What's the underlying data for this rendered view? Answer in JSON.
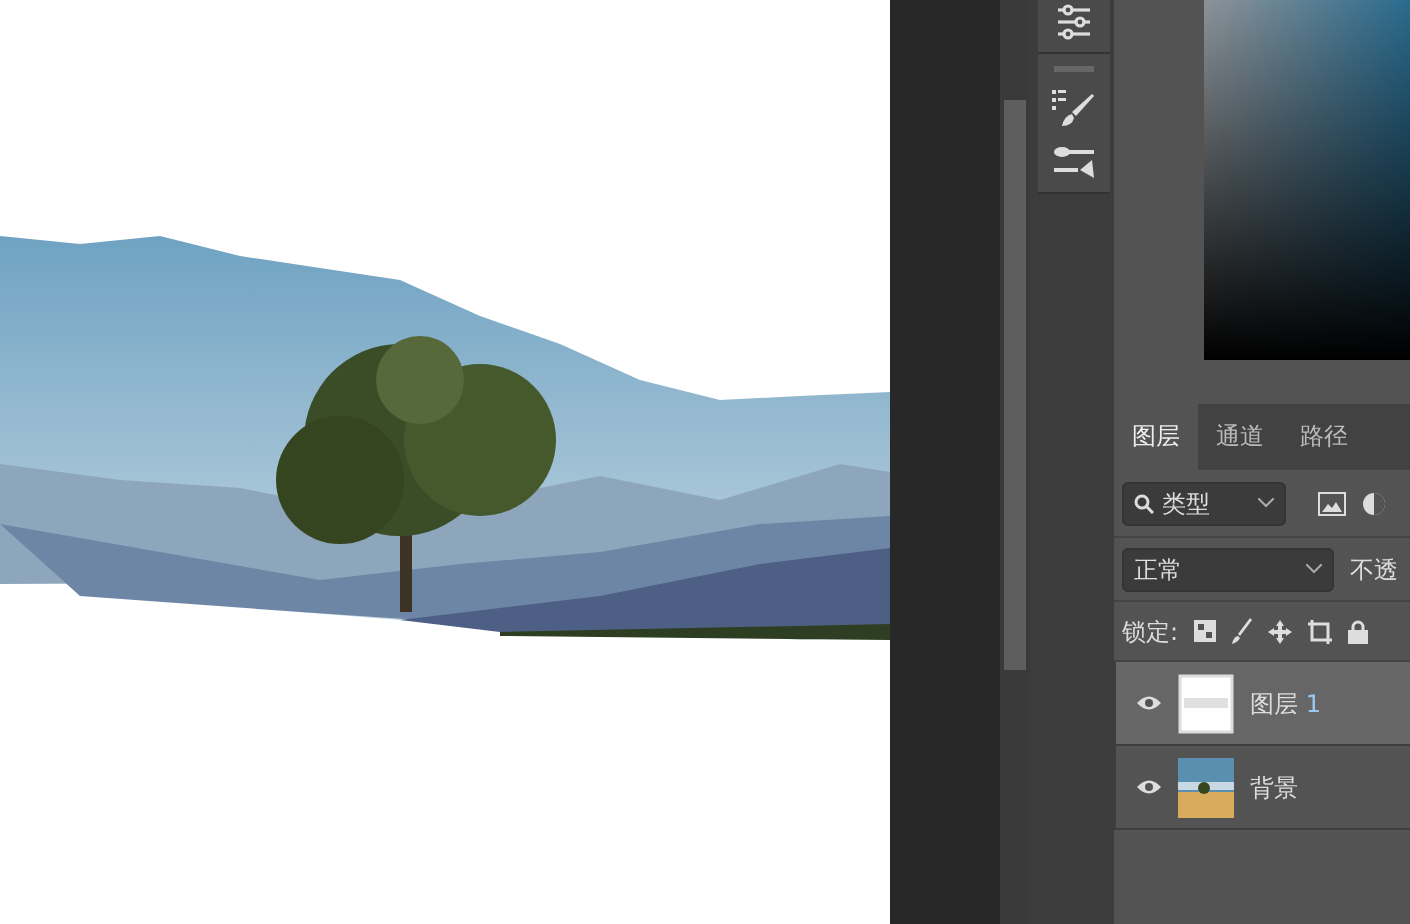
{
  "layers_panel": {
    "tabs": [
      {
        "label": "图层",
        "selected": true
      },
      {
        "label": "通道",
        "selected": false
      },
      {
        "label": "路径",
        "selected": false
      }
    ],
    "filter": {
      "value": "类型"
    },
    "blend_mode": {
      "value": "正常"
    },
    "opacity_label": "不透",
    "lock_label": "锁定:",
    "layers": [
      {
        "name": "图层",
        "suffix": "1",
        "selected": true,
        "visible": true,
        "kind": "transparent"
      },
      {
        "name": "背景",
        "selected": false,
        "visible": true,
        "kind": "photo"
      }
    ]
  }
}
